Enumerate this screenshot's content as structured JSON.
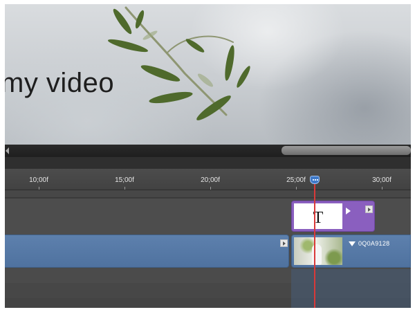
{
  "preview": {
    "overlay_title": "my video"
  },
  "timeline": {
    "ruler_ticks": [
      "10;00f",
      "15;00f",
      "20;00f",
      "25;00f",
      "30;00f"
    ],
    "title_clip": {
      "letter": "T"
    },
    "video_clip": {
      "name": "0Q0A9128"
    }
  },
  "colors": {
    "title_clip": "#8a5fbf",
    "video_clip": "#5d80ad",
    "playhead": "#d93939",
    "playhead_handle": "#3f79c8"
  },
  "icons": {
    "playhead": "playhead-marker-icon",
    "clip_end": "clip-end-marker-icon",
    "scroll_left": "scroll-left-arrow-icon"
  }
}
